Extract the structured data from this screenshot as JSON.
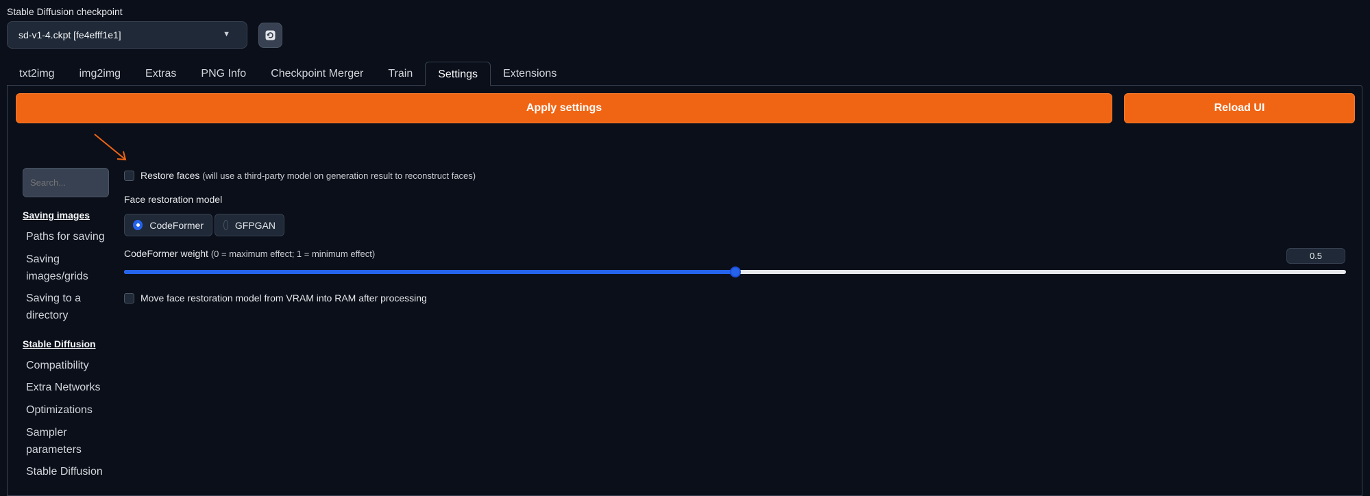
{
  "checkpoint": {
    "label": "Stable Diffusion checkpoint",
    "selected": "sd-v1-4.ckpt [fe4efff1e1]",
    "refresh_icon": "refresh-icon"
  },
  "tabs": [
    {
      "label": "txt2img"
    },
    {
      "label": "img2img"
    },
    {
      "label": "Extras"
    },
    {
      "label": "PNG Info"
    },
    {
      "label": "Checkpoint Merger"
    },
    {
      "label": "Train"
    },
    {
      "label": "Settings",
      "active": true
    },
    {
      "label": "Extensions"
    }
  ],
  "actions": {
    "apply_label": "Apply settings",
    "reload_label": "Reload UI"
  },
  "sidebar": {
    "search_placeholder": "Search...",
    "sections": [
      {
        "heading": "Saving images",
        "items": [
          "Paths for saving",
          "Saving images/grids",
          "Saving to a directory"
        ]
      },
      {
        "heading": "Stable Diffusion",
        "items": [
          "Compatibility",
          "Extra Networks",
          "Optimizations",
          "Sampler parameters",
          "Stable Diffusion"
        ]
      }
    ]
  },
  "settings": {
    "restore_faces": {
      "label": "Restore faces",
      "note": "(will use a third-party model on generation result to reconstruct faces)",
      "checked": false
    },
    "face_model": {
      "label": "Face restoration model",
      "options": [
        "CodeFormer",
        "GFPGAN"
      ],
      "selected": "CodeFormer"
    },
    "codeformer_weight": {
      "label": "CodeFormer weight",
      "note": "(0 = maximum effect; 1 = minimum effect)",
      "value": "0.5",
      "fraction": 0.5
    },
    "move_to_ram": {
      "label": "Move face restoration model from VRAM into RAM after processing",
      "checked": false
    }
  },
  "colors": {
    "accent_orange": "#f06514",
    "accent_blue": "#2563eb",
    "background": "#0b0f19"
  }
}
